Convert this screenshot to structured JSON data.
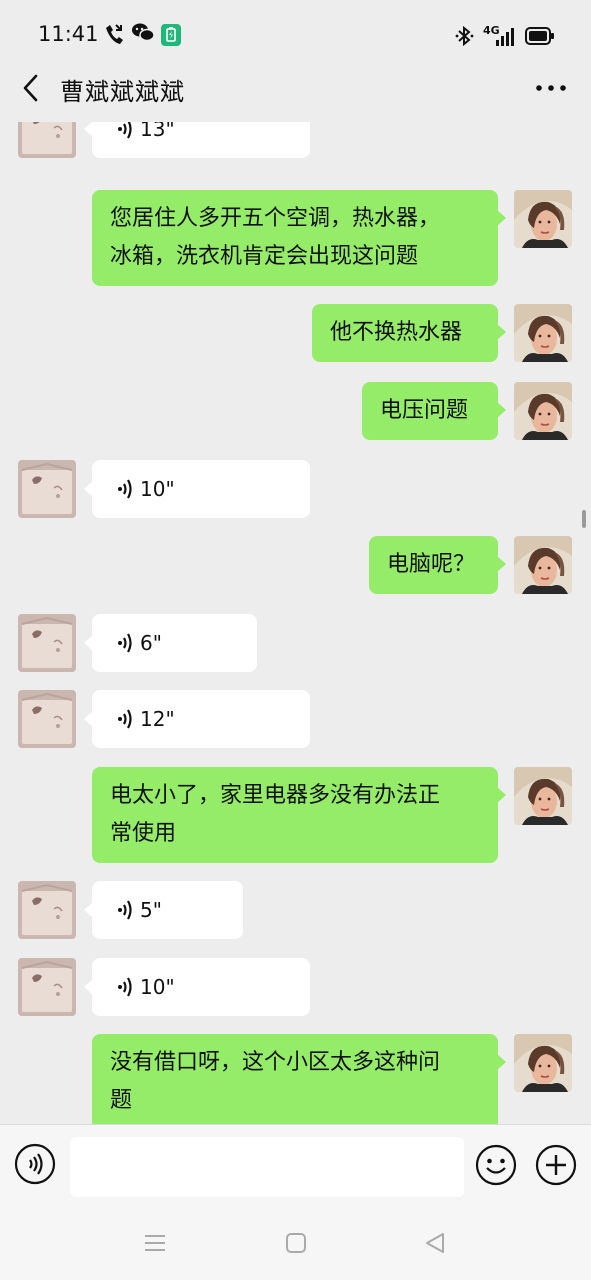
{
  "status_bar": {
    "time": "11:41",
    "network_label": "4G",
    "icons": [
      "missed-call-icon",
      "wechat-icon",
      "battery-saver-icon",
      "bluetooth-icon",
      "signal-icon",
      "battery-icon"
    ]
  },
  "header": {
    "title": "曹斌斌斌斌",
    "back_icon": "chevron-left-icon",
    "more_icon": "more-horizontal-icon"
  },
  "colors": {
    "background": "#ededed",
    "sent_bubble": "#95ec69",
    "received_bubble": "#ffffff",
    "bar_background": "#f6f6f6"
  },
  "messages": [
    {
      "side": "left",
      "type": "voice",
      "duration": "13\""
    },
    {
      "side": "right",
      "type": "text",
      "lines": [
        "您居住人多开五个空调，热水器，",
        "冰箱，洗衣机肯定会出现这问题"
      ]
    },
    {
      "side": "right",
      "type": "text",
      "lines": [
        "他不换热水器"
      ]
    },
    {
      "side": "right",
      "type": "text",
      "lines": [
        "电压问题"
      ]
    },
    {
      "side": "left",
      "type": "voice",
      "duration": "10\""
    },
    {
      "side": "right",
      "type": "text",
      "lines": [
        "电脑呢？"
      ]
    },
    {
      "side": "left",
      "type": "voice",
      "duration": "6\""
    },
    {
      "side": "left",
      "type": "voice",
      "duration": "12\""
    },
    {
      "side": "right",
      "type": "text",
      "lines": [
        "电太小了，家里电器多没有办法正",
        "常使用"
      ]
    },
    {
      "side": "left",
      "type": "voice",
      "duration": "5\""
    },
    {
      "side": "left",
      "type": "voice",
      "duration": "10\""
    },
    {
      "side": "right",
      "type": "text",
      "lines": [
        "没有借口呀，这个小区太多这种问",
        "题"
      ]
    }
  ],
  "input_bar": {
    "placeholder": "",
    "voice_icon": "voice-input-icon",
    "emoji_icon": "emoji-icon",
    "plus_icon": "plus-circle-icon"
  },
  "nav_bar": {
    "icons": [
      "menu-icon",
      "home-square-icon",
      "back-triangle-icon"
    ]
  }
}
